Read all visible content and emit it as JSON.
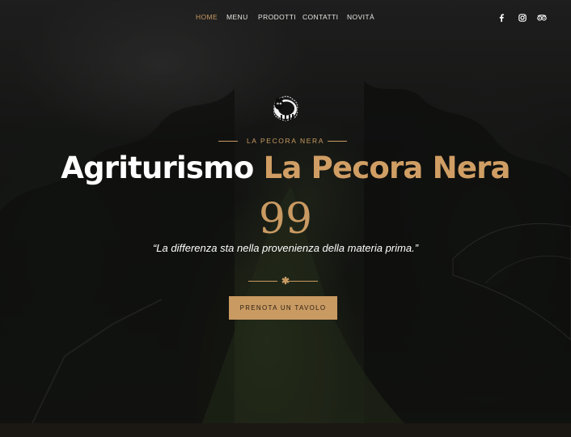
{
  "nav": {
    "items": [
      {
        "label": "HOME",
        "active": true
      },
      {
        "label": "MENU",
        "active": false
      },
      {
        "label": "PRODOTTI",
        "active": false
      },
      {
        "label": "CONTATTI",
        "active": false
      },
      {
        "label": "NOVITÀ",
        "active": false
      }
    ],
    "social_icons": [
      "facebook-icon",
      "instagram-icon",
      "tripadvisor-icon"
    ]
  },
  "hero": {
    "logo_icon": "black-sheep-logo",
    "kicker": "LA PECORA NERA",
    "title_white": "Agriturismo",
    "title_accent": "La Pecora Nera",
    "quote_mark": "99",
    "tagline": "“La differenza sta nella provenienza della materia prima.”",
    "divider_symbol": "✱",
    "cta_label": "PRENOTA UN TAVOLO"
  },
  "colors": {
    "accent": "#c99a62",
    "text": "#ffffff",
    "background": "#1c1d1b"
  }
}
